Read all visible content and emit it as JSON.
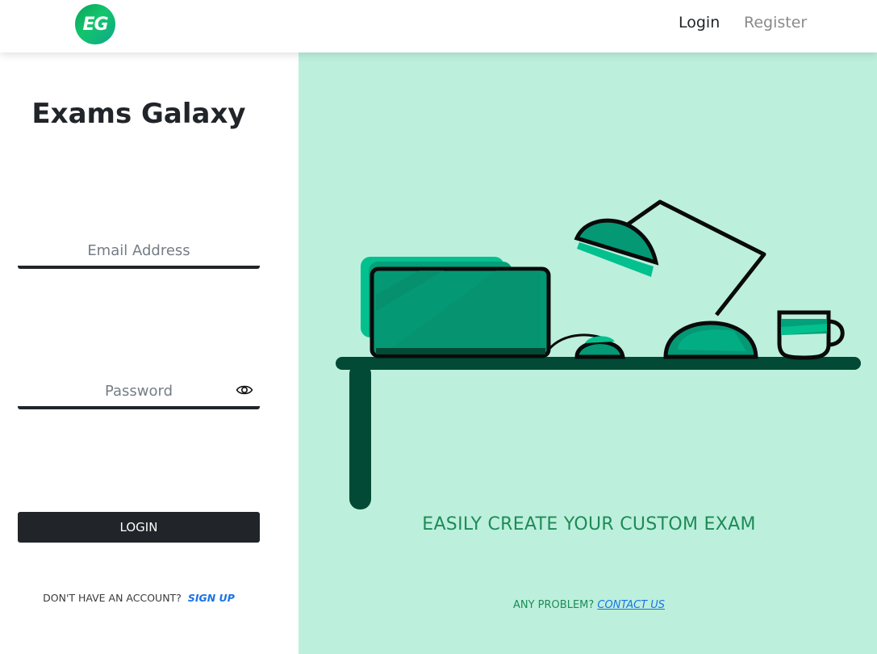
{
  "header": {
    "logo_text": "EG",
    "nav": {
      "login": "Login",
      "register": "Register"
    }
  },
  "login_panel": {
    "title": "Exams Galaxy",
    "email": {
      "placeholder": "Email Address",
      "value": ""
    },
    "password": {
      "placeholder": "Password",
      "value": "",
      "toggle_icon": "eye-icon"
    },
    "submit_label": "LOGIN",
    "signup_prompt": "DON'T HAVE AN ACCOUNT?",
    "signup_link": "SIGN UP"
  },
  "promo_panel": {
    "illustration": "desk-with-laptop-lamp-mug",
    "tagline": "EASILY CREATE YOUR CUSTOM EXAM",
    "contact_prompt": "ANY PROBLEM?",
    "contact_link": "CONTACT US"
  },
  "colors": {
    "primary_dark": "#212529",
    "promo_background": "#bcf0dc",
    "accent_green": "#1f8a58",
    "link_blue": "#1a73e8",
    "desk": "#024a35",
    "illustration_teal": "#03a07a"
  }
}
